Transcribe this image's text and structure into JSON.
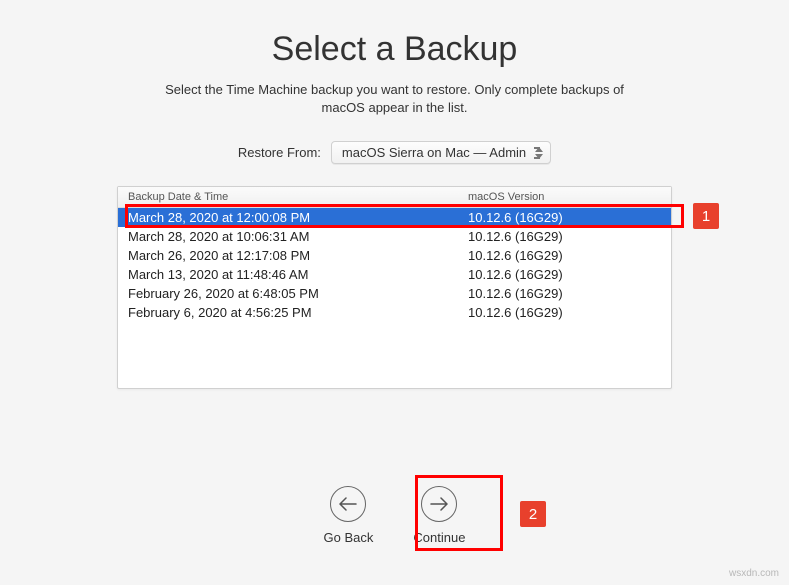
{
  "title": "Select a Backup",
  "subtitle": "Select the Time Machine backup you want to restore. Only complete backups of macOS appear in the list.",
  "restore": {
    "label": "Restore From:",
    "selected": "macOS Sierra on Mac — Admin"
  },
  "table": {
    "headers": {
      "date": "Backup Date & Time",
      "version": "macOS Version"
    },
    "rows": [
      {
        "date": "March 28, 2020 at 12:00:08 PM",
        "version": "10.12.6 (16G29)",
        "selected": true
      },
      {
        "date": "March 28, 2020 at 10:06:31 AM",
        "version": "10.12.6 (16G29)",
        "selected": false
      },
      {
        "date": "March 26, 2020 at 12:17:08 PM",
        "version": "10.12.6 (16G29)",
        "selected": false
      },
      {
        "date": "March 13, 2020 at 11:48:46 AM",
        "version": "10.12.6 (16G29)",
        "selected": false
      },
      {
        "date": "February 26, 2020 at 6:48:05 PM",
        "version": "10.12.6 (16G29)",
        "selected": false
      },
      {
        "date": "February 6, 2020 at 4:56:25 PM",
        "version": "10.12.6 (16G29)",
        "selected": false
      }
    ]
  },
  "buttons": {
    "back": "Go Back",
    "continue": "Continue"
  },
  "annotations": {
    "badge1": "1",
    "badge2": "2"
  },
  "watermark": "wsxdn.com"
}
